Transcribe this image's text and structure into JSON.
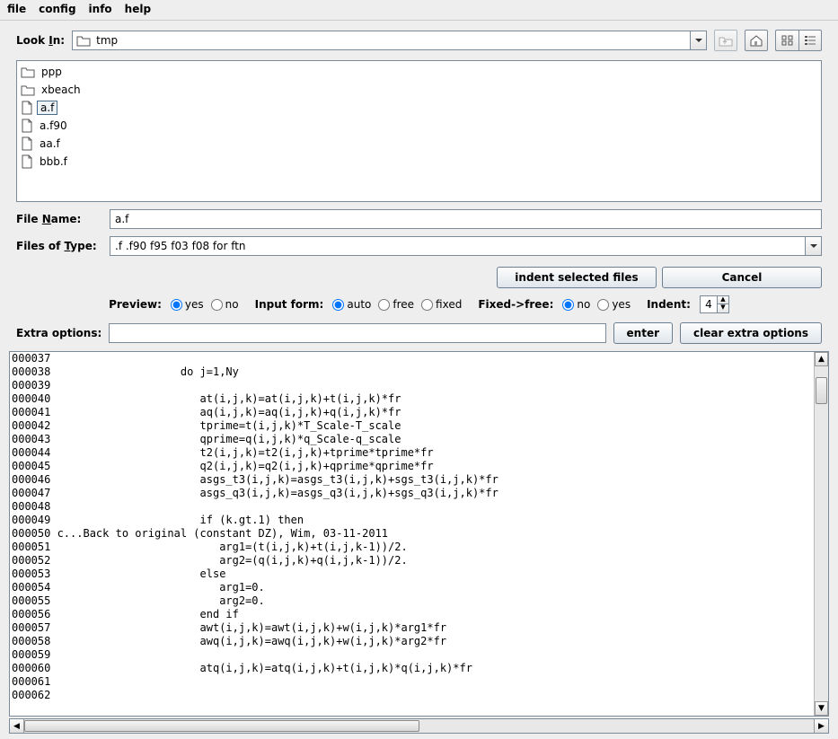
{
  "menu": {
    "file": "file",
    "config": "config",
    "info": "info",
    "help": "help"
  },
  "chooser": {
    "look_in_label": "Look In:",
    "look_in_value": "tmp",
    "files": [
      {
        "name": "ppp",
        "type": "folder",
        "selected": false
      },
      {
        "name": "xbeach",
        "type": "folder",
        "selected": false
      },
      {
        "name": "a.f",
        "type": "file",
        "selected": true
      },
      {
        "name": "a.f90",
        "type": "file",
        "selected": false
      },
      {
        "name": "aa.f",
        "type": "file",
        "selected": false
      },
      {
        "name": "bbb.f",
        "type": "file",
        "selected": false
      }
    ],
    "file_name_label": "File Name:",
    "file_name_value": "a.f",
    "files_of_type_label": "Files of Type:",
    "files_of_type_value": ".f .f90 f95 f03 f08 for ftn"
  },
  "buttons": {
    "indent_selected": "indent selected files",
    "cancel": "Cancel",
    "enter": "enter",
    "clear_extra": "clear extra options"
  },
  "options": {
    "preview": {
      "label": "Preview:",
      "yes": "yes",
      "no": "no",
      "selected": "yes"
    },
    "input_form": {
      "label": "Input form:",
      "auto": "auto",
      "free": "free",
      "fixed": "fixed",
      "selected": "auto"
    },
    "fixed_free": {
      "label": "Fixed->free:",
      "no": "no",
      "yes": "yes",
      "selected": "no"
    },
    "indent": {
      "label": "Indent:",
      "value": "4"
    },
    "extra_label": "Extra options:",
    "extra_value": ""
  },
  "preview_lines": [
    "000037",
    "000038                    do j=1,Ny",
    "000039",
    "000040                       at(i,j,k)=at(i,j,k)+t(i,j,k)*fr",
    "000041                       aq(i,j,k)=aq(i,j,k)+q(i,j,k)*fr",
    "000042                       tprime=t(i,j,k)*T_Scale-T_scale",
    "000043                       qprime=q(i,j,k)*q_Scale-q_scale",
    "000044                       t2(i,j,k)=t2(i,j,k)+tprime*tprime*fr",
    "000045                       q2(i,j,k)=q2(i,j,k)+qprime*qprime*fr",
    "000046                       asgs_t3(i,j,k)=asgs_t3(i,j,k)+sgs_t3(i,j,k)*fr",
    "000047                       asgs_q3(i,j,k)=asgs_q3(i,j,k)+sgs_q3(i,j,k)*fr",
    "000048",
    "000049                       if (k.gt.1) then",
    "000050 c...Back to original (constant DZ), Wim, 03-11-2011",
    "000051                          arg1=(t(i,j,k)+t(i,j,k-1))/2.",
    "000052                          arg2=(q(i,j,k)+q(i,j,k-1))/2.",
    "000053                       else",
    "000054                          arg1=0.",
    "000055                          arg2=0.",
    "000056                       end if",
    "000057                       awt(i,j,k)=awt(i,j,k)+w(i,j,k)*arg1*fr",
    "000058                       awq(i,j,k)=awq(i,j,k)+w(i,j,k)*arg2*fr",
    "000059",
    "000060                       atq(i,j,k)=atq(i,j,k)+t(i,j,k)*q(i,j,k)*fr",
    "000061",
    "000062"
  ]
}
